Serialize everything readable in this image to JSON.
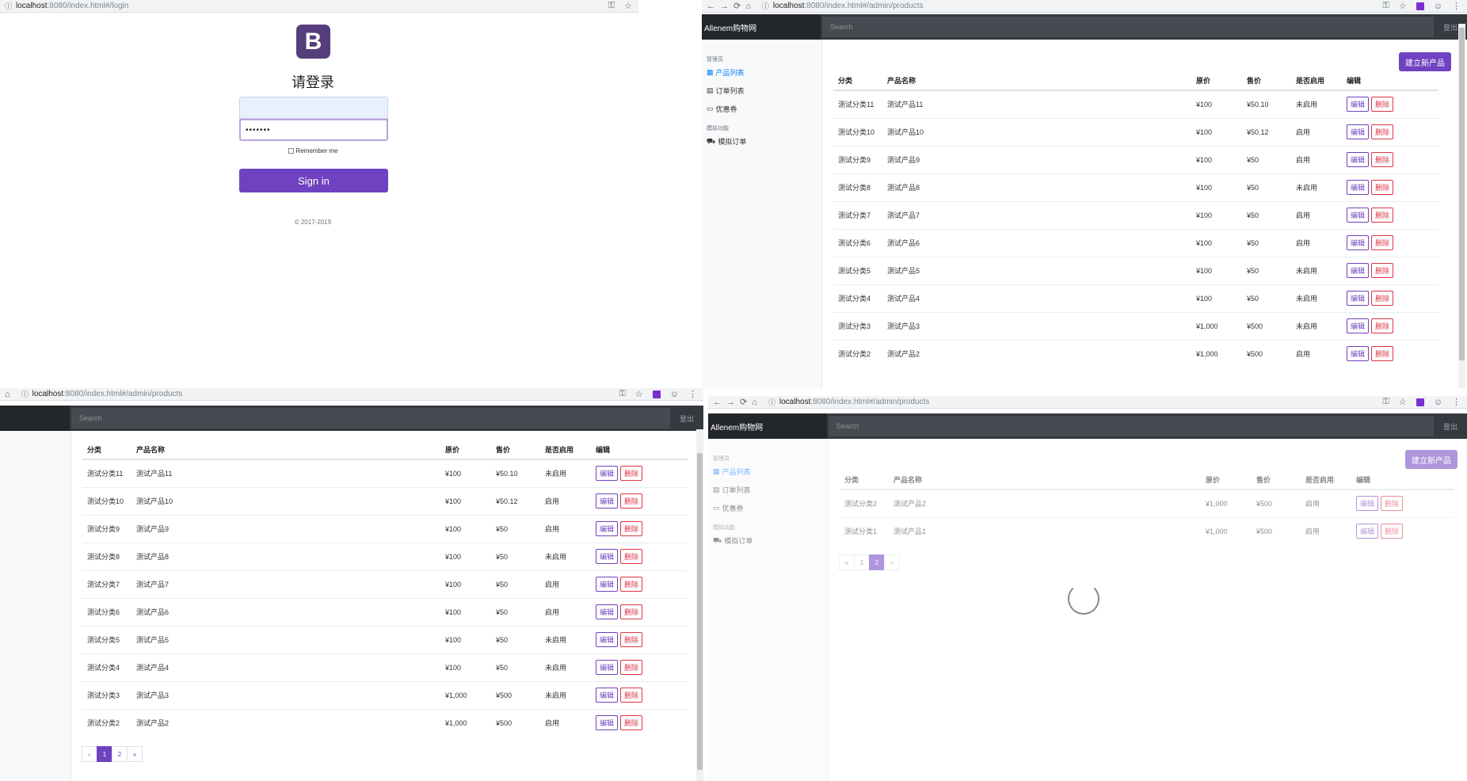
{
  "login_window": {
    "url_host": "localhost",
    "url_path": ":8080/index.html#/login",
    "logo_letter": "B",
    "title": "请登录",
    "username_value": "",
    "password_value": "•••••••",
    "remember_label": "Remember me",
    "signin_label": "Sign in",
    "copyright": "© 2017-2019"
  },
  "admin": {
    "url_host": "localhost",
    "url_path": ":8080/index.html#/admin/products",
    "brand": "Allenem购物网",
    "search_placeholder": "Search",
    "logout": "登出",
    "new_product": "建立新产品",
    "sidebar": {
      "group1": "管理员",
      "items1": [
        "产品列表",
        "订单列表",
        "优惠券"
      ],
      "group2": "模拟功能",
      "items2": [
        "模拟订单"
      ]
    },
    "headers": [
      "分类",
      "产品名称",
      "原价",
      "售价",
      "是否启用",
      "编辑"
    ],
    "edit_label": "编辑",
    "delete_label": "删除",
    "page1_rows": [
      {
        "category": "测试分类11",
        "name": "测试产品11",
        "origin": "¥100",
        "price": "¥50.10",
        "status": "未启用",
        "on": false
      },
      {
        "category": "测试分类10",
        "name": "测试产品10",
        "origin": "¥100",
        "price": "¥50.12",
        "status": "启用",
        "on": true
      },
      {
        "category": "测试分类9",
        "name": "测试产品9",
        "origin": "¥100",
        "price": "¥50",
        "status": "启用",
        "on": true
      },
      {
        "category": "测试分类8",
        "name": "测试产品8",
        "origin": "¥100",
        "price": "¥50",
        "status": "未启用",
        "on": false
      },
      {
        "category": "测试分类7",
        "name": "测试产品7",
        "origin": "¥100",
        "price": "¥50",
        "status": "启用",
        "on": true
      },
      {
        "category": "测试分类6",
        "name": "测试产品6",
        "origin": "¥100",
        "price": "¥50",
        "status": "启用",
        "on": true
      },
      {
        "category": "测试分类5",
        "name": "测试产品5",
        "origin": "¥100",
        "price": "¥50",
        "status": "未启用",
        "on": false
      },
      {
        "category": "测试分类4",
        "name": "测试产品4",
        "origin": "¥100",
        "price": "¥50",
        "status": "未启用",
        "on": false
      },
      {
        "category": "测试分类3",
        "name": "测试产品3",
        "origin": "¥1,000",
        "price": "¥500",
        "status": "未启用",
        "on": false
      },
      {
        "category": "测试分类2",
        "name": "测试产品2",
        "origin": "¥1,000",
        "price": "¥500",
        "status": "启用",
        "on": true
      }
    ],
    "page2_rows": [
      {
        "category": "测试分类2",
        "name": "测试产品2",
        "origin": "¥1,000",
        "price": "¥500",
        "status": "启用",
        "on": true
      },
      {
        "category": "测试分类1",
        "name": "测试产品1",
        "origin": "¥1,000",
        "price": "¥500",
        "status": "启用",
        "on": true
      }
    ],
    "pager": {
      "prev": "«",
      "pages": [
        "1",
        "2"
      ],
      "next": "»"
    }
  }
}
